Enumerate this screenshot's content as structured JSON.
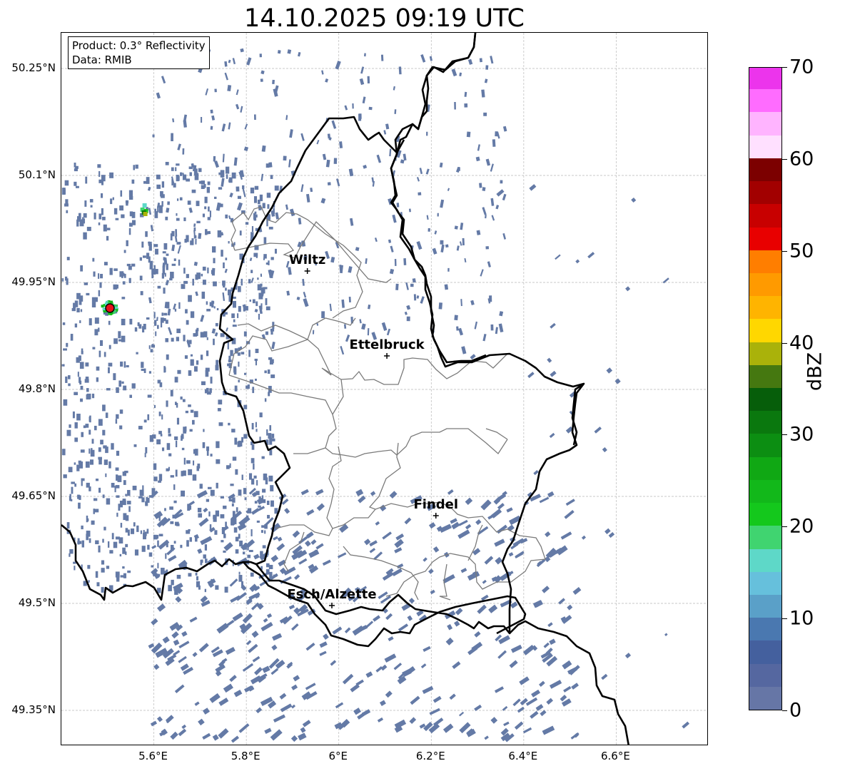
{
  "title": "14.10.2025 09:19 UTC",
  "info": {
    "product": "Product: 0.3° Reflectivity",
    "data": "Data: RMIB"
  },
  "axes": {
    "y_ticks": [
      "50.25°N",
      "50.1°N",
      "49.95°N",
      "49.8°N",
      "49.65°N",
      "49.5°N",
      "49.35°N"
    ],
    "x_ticks": [
      "5.6°E",
      "5.8°E",
      "6°E",
      "6.2°E",
      "6.4°E",
      "6.6°E"
    ]
  },
  "cities": [
    {
      "name": "Wiltz",
      "lon": 5.932,
      "lat": 49.966
    },
    {
      "name": "Ettelbruck",
      "lon": 6.104,
      "lat": 49.847
    },
    {
      "name": "Findel",
      "lon": 6.21,
      "lat": 49.623
    },
    {
      "name": "Esch/Alzette",
      "lon": 5.985,
      "lat": 49.497
    }
  ],
  "radar_site": {
    "lon": 5.505,
    "lat": 49.914,
    "color": "#e8111a"
  },
  "colorbar": {
    "label": "dBZ",
    "min": 0,
    "max": 70,
    "ticks": [
      "0",
      "10",
      "20",
      "30",
      "40",
      "50",
      "60",
      "70"
    ],
    "step": 2.5,
    "colors": [
      "#6676a6",
      "#5567a0",
      "#44609e",
      "#4a78b0",
      "#5aa0c8",
      "#66c0dc",
      "#5ed8c8",
      "#40d470",
      "#14c81c",
      "#12b81a",
      "#10a814",
      "#0c8e12",
      "#0a780e",
      "#065e0a",
      "#457810",
      "#aab20a",
      "#ffd700",
      "#ffb400",
      "#ff9a00",
      "#ff7e00",
      "#e80000",
      "#c80000",
      "#a20000",
      "#7c0000",
      "#ffe0ff",
      "#ffb4ff",
      "#ff6cff",
      "#ec34ec"
    ]
  },
  "colors": {
    "echo_base": "#647aa6",
    "border": "#000000",
    "canton": "#7a7a7a",
    "grid": "#b9b9b9"
  }
}
